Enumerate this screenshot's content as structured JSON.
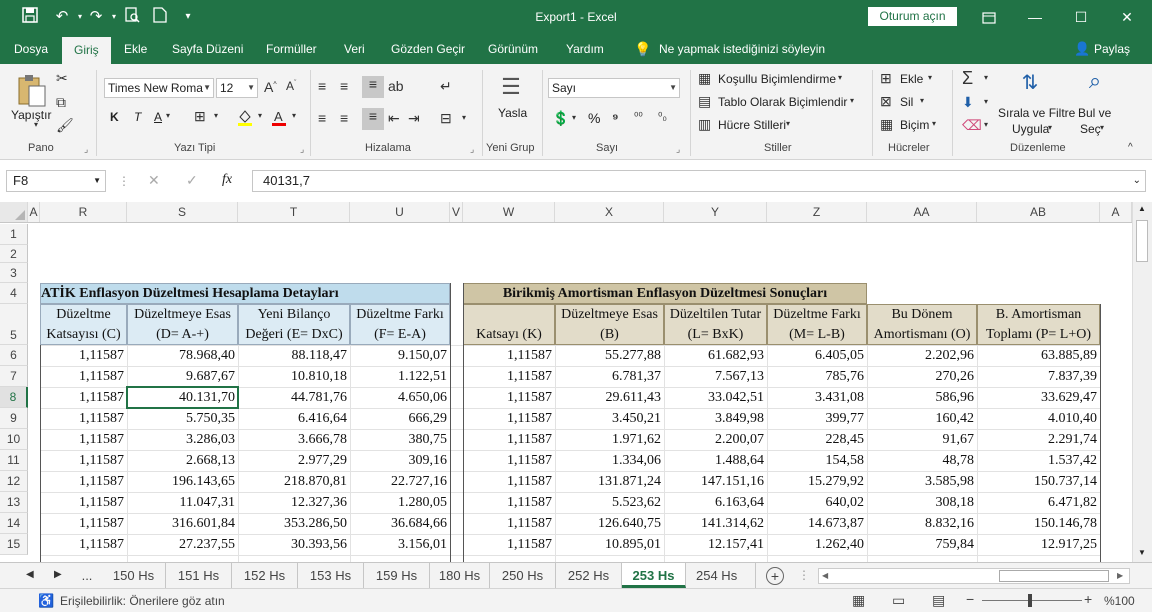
{
  "titlebar": {
    "title": "Export1 - Excel",
    "signin": "Oturum açın",
    "qa_icons": [
      "save-icon",
      "undo-icon",
      "redo-icon",
      "print-preview-icon",
      "new-document-icon",
      "customize-icon"
    ]
  },
  "menu": {
    "tabs": [
      "Dosya",
      "Giriş",
      "Ekle",
      "Sayfa Düzeni",
      "Formüller",
      "Veri",
      "Gözden Geçir",
      "Görünüm",
      "Yardım"
    ],
    "tellme": "Ne yapmak istediğinizi söyleyin",
    "share": "Paylaş"
  },
  "ribbon": {
    "paste": "Yapıştır",
    "font_name": "Times New Roma",
    "font_size": "12",
    "bold": "K",
    "italic": "T",
    "underline": "A",
    "wrap": "Yasla",
    "number_format": "Sayı",
    "percent": "%",
    "cond_format": "Koşullu Biçimlendirme",
    "format_table": "Tablo Olarak Biçimlendir",
    "cell_styles": "Hücre Stilleri",
    "insert": "Ekle",
    "delete": "Sil",
    "format": "Biçim",
    "sort_filter_1": "Sırala ve Filtre",
    "sort_filter_2": "Uygula",
    "find_1": "Bul ve",
    "find_2": "Seç",
    "groups": [
      "Pano",
      "Yazı Tipi",
      "Hizalama",
      "Yeni Grup",
      "Sayı",
      "Stiller",
      "Hücreler",
      "Düzenleme"
    ]
  },
  "formula": {
    "namebox": "F8",
    "fx": "fx",
    "value": "40131,7"
  },
  "grid": {
    "columns": [
      "A",
      "R",
      "S",
      "T",
      "U",
      "V",
      "W",
      "X",
      "Y",
      "Z",
      "AA",
      "AB",
      "A"
    ],
    "row_numbers": [
      "1",
      "2",
      "3",
      "4",
      "5",
      "6",
      "7",
      "8",
      "9",
      "10",
      "11",
      "12",
      "13",
      "14",
      "15"
    ],
    "left_title": "ATİK Enflasyon Düzeltmesi Hesaplama Detayları",
    "right_title": "Birikmiş Amortisman Enflasyon Düzeltmesi Sonuçları",
    "left_headers": [
      [
        "Düzeltme",
        "Katsayısı (C)"
      ],
      [
        "Düzeltmeye Esas",
        "(D= A-+)"
      ],
      [
        "Yeni Bilanço",
        "Değeri (E= DxC)"
      ],
      [
        "Düzeltme Farkı",
        "(F= E-A)"
      ]
    ],
    "right_headers": [
      [
        "",
        "Katsayı (K)"
      ],
      [
        "Düzeltmeye Esas",
        "(B)"
      ],
      [
        "Düzeltilen Tutar",
        "(L= BxK)"
      ],
      [
        "Düzeltme Farkı",
        "(M= L-B)"
      ],
      [
        "Bu Dönem",
        "Amortismanı (O)"
      ],
      [
        "B. Amortisman",
        "Toplamı (P= L+O)"
      ]
    ],
    "rows": [
      [
        "1,11587",
        "78.968,40",
        "88.118,47",
        "9.150,07",
        "1,11587",
        "55.277,88",
        "61.682,93",
        "6.405,05",
        "2.202,96",
        "63.885,89"
      ],
      [
        "1,11587",
        "9.687,67",
        "10.810,18",
        "1.122,51",
        "1,11587",
        "6.781,37",
        "7.567,13",
        "785,76",
        "270,26",
        "7.837,39"
      ],
      [
        "1,11587",
        "40.131,70",
        "44.781,76",
        "4.650,06",
        "1,11587",
        "29.611,43",
        "33.042,51",
        "3.431,08",
        "586,96",
        "33.629,47"
      ],
      [
        "1,11587",
        "5.750,35",
        "6.416,64",
        "666,29",
        "1,11587",
        "3.450,21",
        "3.849,98",
        "399,77",
        "160,42",
        "4.010,40"
      ],
      [
        "1,11587",
        "3.286,03",
        "3.666,78",
        "380,75",
        "1,11587",
        "1.971,62",
        "2.200,07",
        "228,45",
        "91,67",
        "2.291,74"
      ],
      [
        "1,11587",
        "2.668,13",
        "2.977,29",
        "309,16",
        "1,11587",
        "1.334,06",
        "1.488,64",
        "154,58",
        "48,78",
        "1.537,42"
      ],
      [
        "1,11587",
        "196.143,65",
        "218.870,81",
        "22.727,16",
        "1,11587",
        "131.871,24",
        "147.151,16",
        "15.279,92",
        "3.585,98",
        "150.737,14"
      ],
      [
        "1,11587",
        "11.047,31",
        "12.327,36",
        "1.280,05",
        "1,11587",
        "5.523,62",
        "6.163,64",
        "640,02",
        "308,18",
        "6.471,82"
      ],
      [
        "1,11587",
        "316.601,84",
        "353.286,50",
        "36.684,66",
        "1,11587",
        "126.640,75",
        "141.314,62",
        "14.673,87",
        "8.832,16",
        "150.146,78"
      ],
      [
        "1,11587",
        "27.237,55",
        "30.393,56",
        "3.156,01",
        "1,11587",
        "10.895,01",
        "12.157,41",
        "1.262,40",
        "759,84",
        "12.917,25"
      ]
    ]
  },
  "sheets": {
    "ellipsis": "...",
    "tabs": [
      "150 Hs",
      "151 Hs",
      "152 Hs",
      "153 Hs",
      "159 Hs",
      "180 Hs",
      "250 Hs",
      "252 Hs",
      "253 Hs",
      "254 Hs"
    ],
    "active": "253 Hs"
  },
  "status": {
    "accessibility": "Erişilebilirlik: Önerilere göz atın",
    "zoom": "%100"
  },
  "colors": {
    "brand": "#217346",
    "left_header_fill": "#dcebf4",
    "left_title_fill": "#bfdcec",
    "right_title_fill": "#cfc5a5",
    "right_header_fill": "#e2dcc9"
  }
}
